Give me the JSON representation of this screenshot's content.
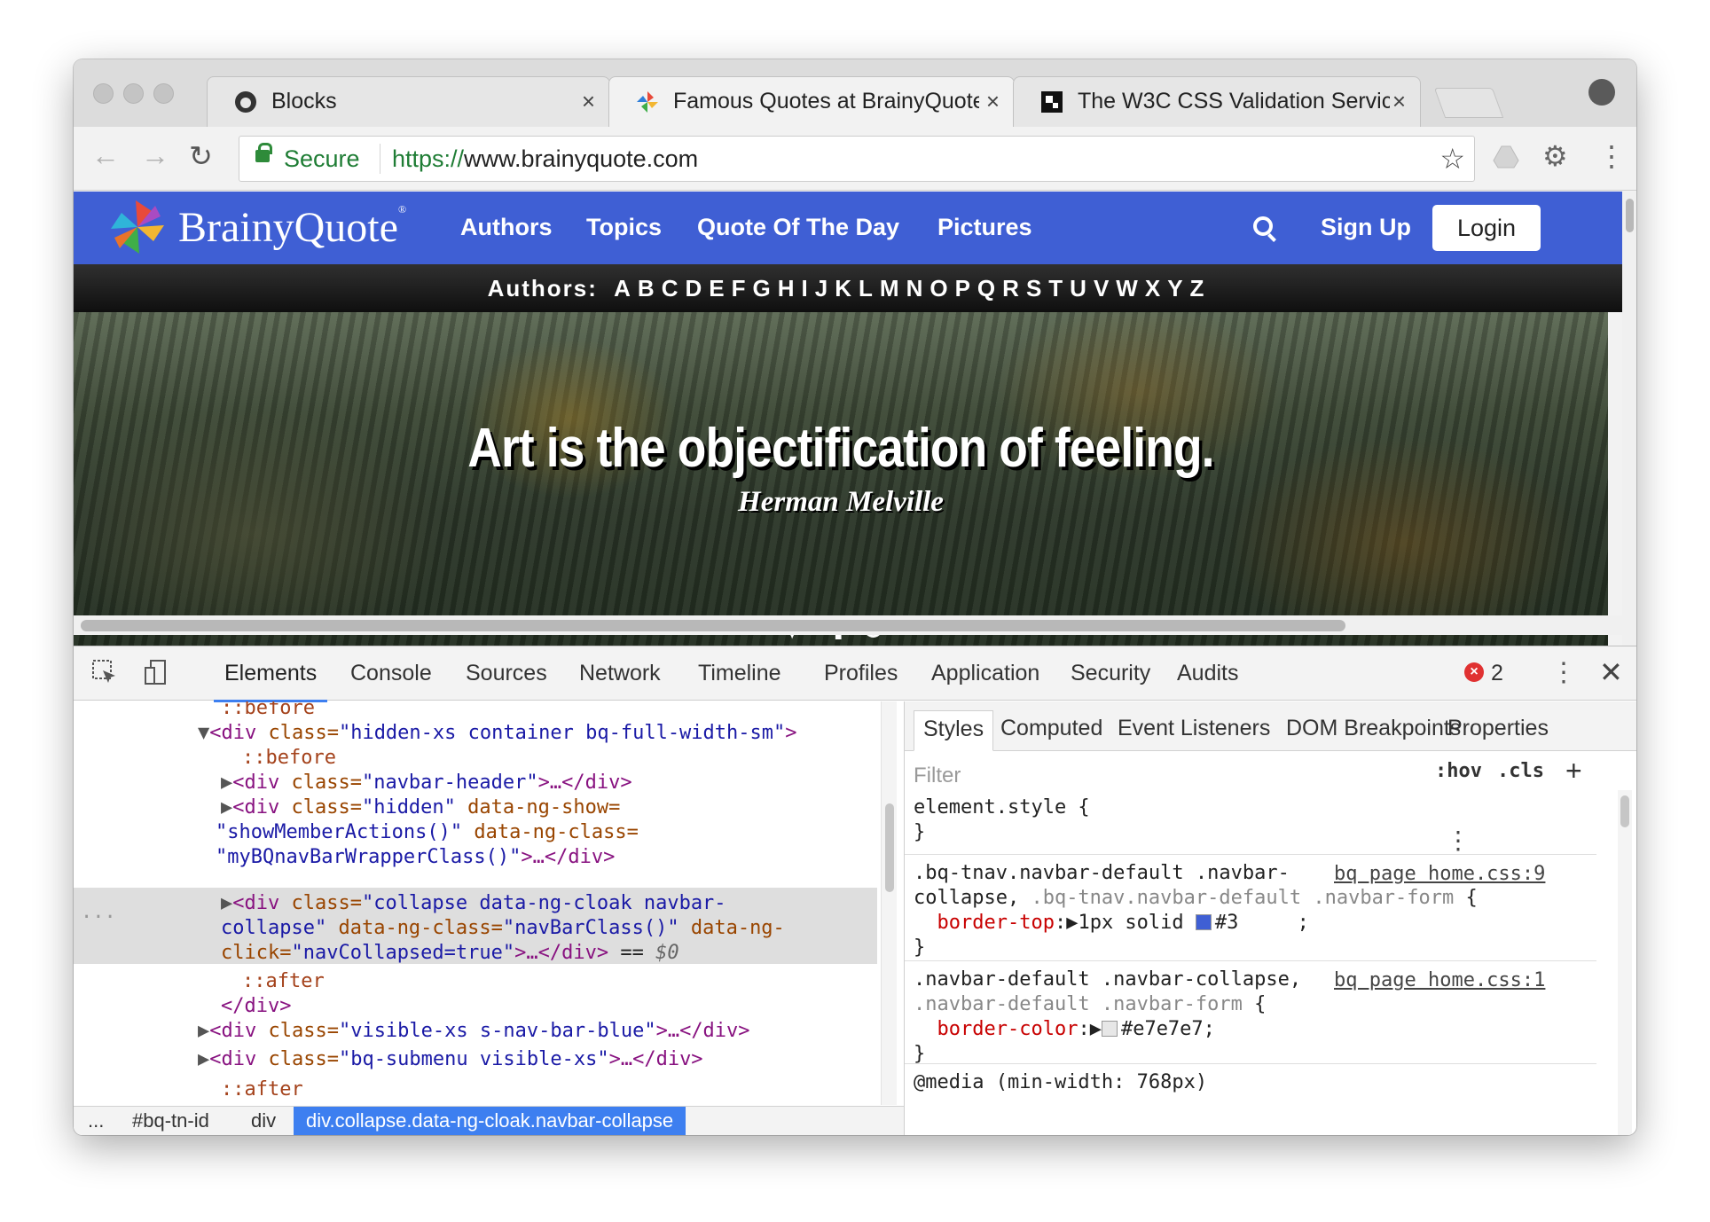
{
  "tabs": [
    {
      "title": "Blocks",
      "close": "×"
    },
    {
      "title": "Famous Quotes at BrainyQuote",
      "close": "×"
    },
    {
      "title": "The W3C CSS Validation Service",
      "close": "×"
    }
  ],
  "toolbar": {
    "back": "←",
    "forward": "→",
    "reload": "↻",
    "secure_label": "Secure",
    "url_scheme": "https://",
    "url_host": "www.brainyquote.com",
    "bookmark": "☆",
    "extension": "⚙",
    "menu": "⋮"
  },
  "site": {
    "logo": "BrainyQuote",
    "logo_mark": "®",
    "nav": [
      "Authors",
      "Topics",
      "Quote Of The Day",
      "Pictures"
    ],
    "signup": "Sign Up",
    "login": "Login",
    "authors_label": "Authors:",
    "letters": [
      "A",
      "B",
      "C",
      "D",
      "E",
      "F",
      "G",
      "H",
      "I",
      "J",
      "K",
      "L",
      "M",
      "N",
      "O",
      "P",
      "Q",
      "R",
      "S",
      "T",
      "U",
      "V",
      "W",
      "X",
      "Y",
      "Z"
    ],
    "quote": "Art is the objectification of feeling.",
    "author": "Herman Melville",
    "actions": {
      "heart": "♥",
      "add": "✚",
      "refresh": "⟳"
    }
  },
  "devtools": {
    "tabs": [
      "Elements",
      "Console",
      "Sources",
      "Network",
      "Timeline",
      "Profiles",
      "Application",
      "Security",
      "Audits"
    ],
    "error_count": "2",
    "error_icon": "×",
    "menu": "⋮",
    "close": "✕",
    "breadcrumbs": [
      "...",
      "#bq-tn-id",
      "div",
      "div.collapse.data-ng-cloak.navbar-collapse"
    ],
    "elements": {
      "before_top": "::before",
      "container_tag": "<div",
      "container_attr": " class=",
      "container_val": "\"hidden-xs container bq-full-width-sm\"",
      "container_close": ">",
      "before": "::before",
      "navbar_header_val": "\"navbar-header\"",
      "hidden_val": "\"hidden\"",
      "ng_show_attr": " data-ng-show=",
      "show_member_val": "\"showMemberActions()\"",
      "ng_class_attr": " data-ng-class=",
      "wrapper_val": "\"myBQnavBarWrapperClass()\"",
      "collapse_val": "\"collapse data-ng-cloak navbar-",
      "collapse_val2": "collapse\"",
      "navbar_class_val": "\"navBarClass()\"",
      "ng_click_attr": " data-ng-",
      "ng_click_attr2": "click=",
      "nav_collapsed_val": "\"navCollapsed=true\"",
      "eq": " == ",
      "dollar": "$0",
      "after": "::after",
      "div_close": "</div>",
      "visible_val": "\"visible-xs s-nav-bar-blue\"",
      "submenu_val": "\"bq-submenu visible-xs\"",
      "after_bottom": "::after",
      "ellipsis_close": ">…</div>",
      "gutter": "..."
    },
    "styles": {
      "tabs": [
        "Styles",
        "Computed",
        "Event Listeners",
        "DOM Breakpoints",
        "Properties"
      ],
      "filter_placeholder": "Filter",
      "hov": ":hov",
      "cls": ".cls",
      "add": "+",
      "element_style": "element.style {",
      "brace_close": "}",
      "rule1_sel_a": ".bq-tnav.navbar-default .navbar-",
      "rule1_sel_b": "collapse, ",
      "rule1_sel_c": ".bq-tnav.navbar-default",
      "rule1_sel_d": " .navbar-form",
      "rule1_source": "bq page home.css:9",
      "rule1_prop": "border-top",
      "rule1_value": "1px solid ",
      "rule1_color": "#3",
      "rule1_color_hex": "#3f5fd4",
      "rule2_sel_a": ".navbar-default .navbar-collapse,",
      "rule2_sel_b": ".navbar-default .navbar-form",
      "rule2_source": "bq page home.css:1",
      "rule2_prop": "border-color",
      "rule2_value": "#e7e7e7;",
      "rule2_color_hex": "#e7e7e7",
      "media": "@media (min-width: 768px)"
    }
  },
  "colors": {
    "brand_blue": "#3f5fd4",
    "selection_blue": "#3d7ff0",
    "secure_green": "#1f7d35"
  }
}
